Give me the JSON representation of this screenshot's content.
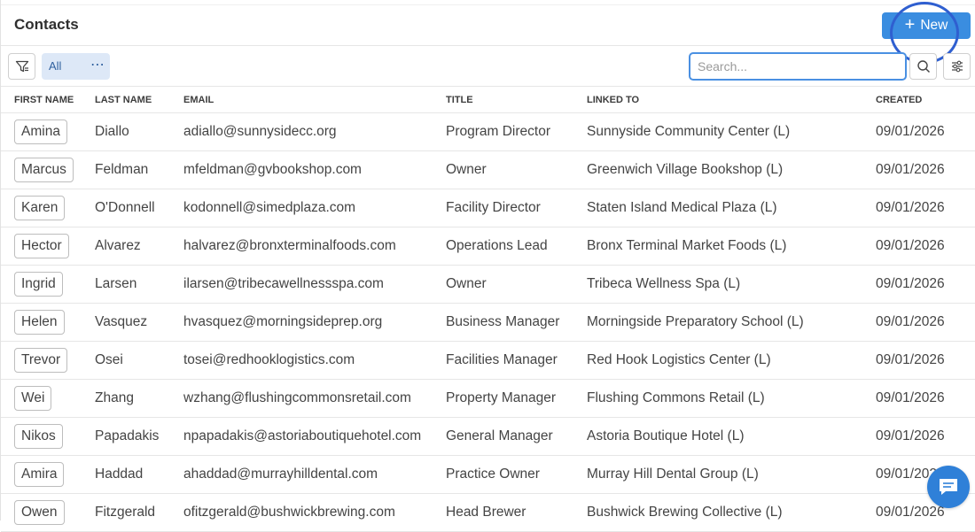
{
  "header": {
    "title": "Contacts",
    "new_label": "New"
  },
  "toolbar": {
    "view_label": "All",
    "view_menu": "⋯",
    "search_placeholder": "Search..."
  },
  "columns": [
    "FIRST NAME",
    "LAST NAME",
    "EMAIL",
    "TITLE",
    "LINKED TO",
    "CREATED"
  ],
  "rows": [
    [
      "Amina",
      "Diallo",
      "adiallo@sunnysidecc.org",
      "Program Director",
      "Sunnyside Community Center (L)",
      "09/01/2026"
    ],
    [
      "Marcus",
      "Feldman",
      "mfeldman@gvbookshop.com",
      "Owner",
      "Greenwich Village Bookshop (L)",
      "09/01/2026"
    ],
    [
      "Karen",
      "O'Donnell",
      "kodonnell@simedplaza.com",
      "Facility Director",
      "Staten Island Medical Plaza (L)",
      "09/01/2026"
    ],
    [
      "Hector",
      "Alvarez",
      "halvarez@bronxterminalfoods.com",
      "Operations Lead",
      "Bronx Terminal Market Foods (L)",
      "09/01/2026"
    ],
    [
      "Ingrid",
      "Larsen",
      "ilarsen@tribecawellnessspa.com",
      "Owner",
      "Tribeca Wellness Spa (L)",
      "09/01/2026"
    ],
    [
      "Helen",
      "Vasquez",
      "hvasquez@morningsideprep.org",
      "Business Manager",
      "Morningside Preparatory School (L)",
      "09/01/2026"
    ],
    [
      "Trevor",
      "Osei",
      "tosei@redhooklogistics.com",
      "Facilities Manager",
      "Red Hook Logistics Center (L)",
      "09/01/2026"
    ],
    [
      "Wei",
      "Zhang",
      "wzhang@flushingcommonsretail.com",
      "Property Manager",
      "Flushing Commons Retail (L)",
      "09/01/2026"
    ],
    [
      "Nikos",
      "Papadakis",
      "npapadakis@astoriaboutiquehotel.com",
      "General Manager",
      "Astoria Boutique Hotel (L)",
      "09/01/2026"
    ],
    [
      "Amira",
      "Haddad",
      "ahaddad@murrayhilldental.com",
      "Practice Owner",
      "Murray Hill Dental Group (L)",
      "09/01/2026"
    ],
    [
      "Owen",
      "Fitzgerald",
      "ofitzgerald@bushwickbrewing.com",
      "Head Brewer",
      "Bushwick Brewing Collective (L)",
      "09/01/2026"
    ]
  ],
  "icons": {
    "filter": "filter-icon",
    "search": "search-icon",
    "settings": "sliders-icon",
    "plus": "plus-icon",
    "chat": "chat-icon"
  },
  "colors": {
    "accent": "#3a8de0",
    "chip_bg": "#dde8f7",
    "focus_ring": "#2f5fd0"
  }
}
